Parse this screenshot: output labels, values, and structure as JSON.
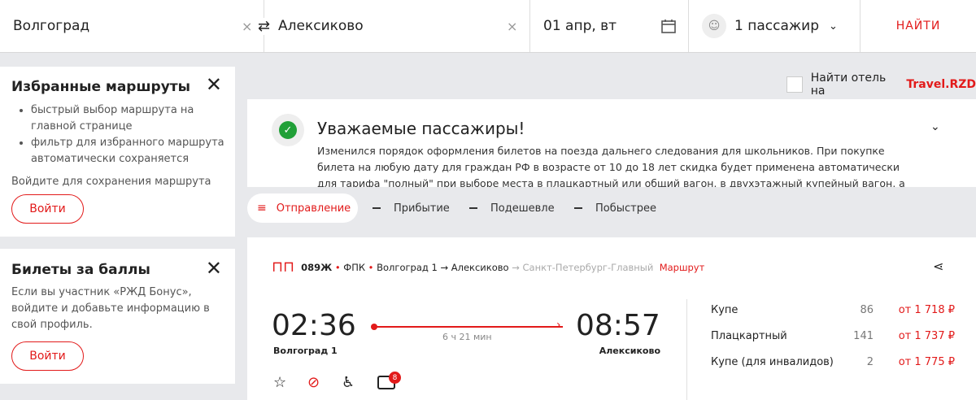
{
  "search": {
    "from": "Волгоград",
    "to": "Алексиково",
    "date": "01 апр, вт",
    "passengers": "1 пассажир",
    "find": "НАЙТИ"
  },
  "favorites": {
    "title": "Избранные маршруты",
    "items": [
      "быстрый выбор маршрута на главной странице",
      "фильтр для избранного маршрута автоматически сохраняется"
    ],
    "hint": "Войдите для сохранения маршрута",
    "login": "Войти"
  },
  "bonus": {
    "title": "Билеты за баллы",
    "text": "Если вы участник «РЖД Бонус», войдите и добавьте информацию в свой профиль.",
    "login": "Войти"
  },
  "hotel": {
    "label": "Найти отель на ",
    "brand": "Travel.RZD"
  },
  "notice": {
    "title": "Уважаемые пассажиры!",
    "text": "Изменился порядок оформления билетов на поезда дальнего следования для школьников. При покупке билета на любую дату для граждан РФ в возрасте от 10 до 18 лет скидка будет применена автоматически для тарифа \"полный\" при выборе места в плацкартный или общий вагон, в двухэтажный купейный вагон, а также на места"
  },
  "sort": [
    "Отправление",
    "Прибытие",
    "Подешевле",
    "Побыстрее"
  ],
  "train": {
    "number": "089Ж",
    "carrier": "ФПК",
    "segment": "Волгоград 1 → Алексиково",
    "rest": "→ Санкт-Петербург-Главный",
    "route_link": "Маршрут",
    "dep_time": "02:36",
    "arr_time": "08:57",
    "duration": "6 ч 21 мин",
    "dep_station": "Волгоград 1",
    "arr_station": "Алексиково",
    "badge": "8",
    "classes": [
      {
        "name": "Купе",
        "seats": "86",
        "price": "от 1 718 ₽"
      },
      {
        "name": "Плацкартный",
        "seats": "141",
        "price": "от 1 737 ₽"
      },
      {
        "name": "Купе (для инвалидов)",
        "seats": "2",
        "price": "от 1 775 ₽"
      }
    ]
  },
  "colors": {
    "accent": "#e21a1a",
    "success": "#21a038"
  }
}
